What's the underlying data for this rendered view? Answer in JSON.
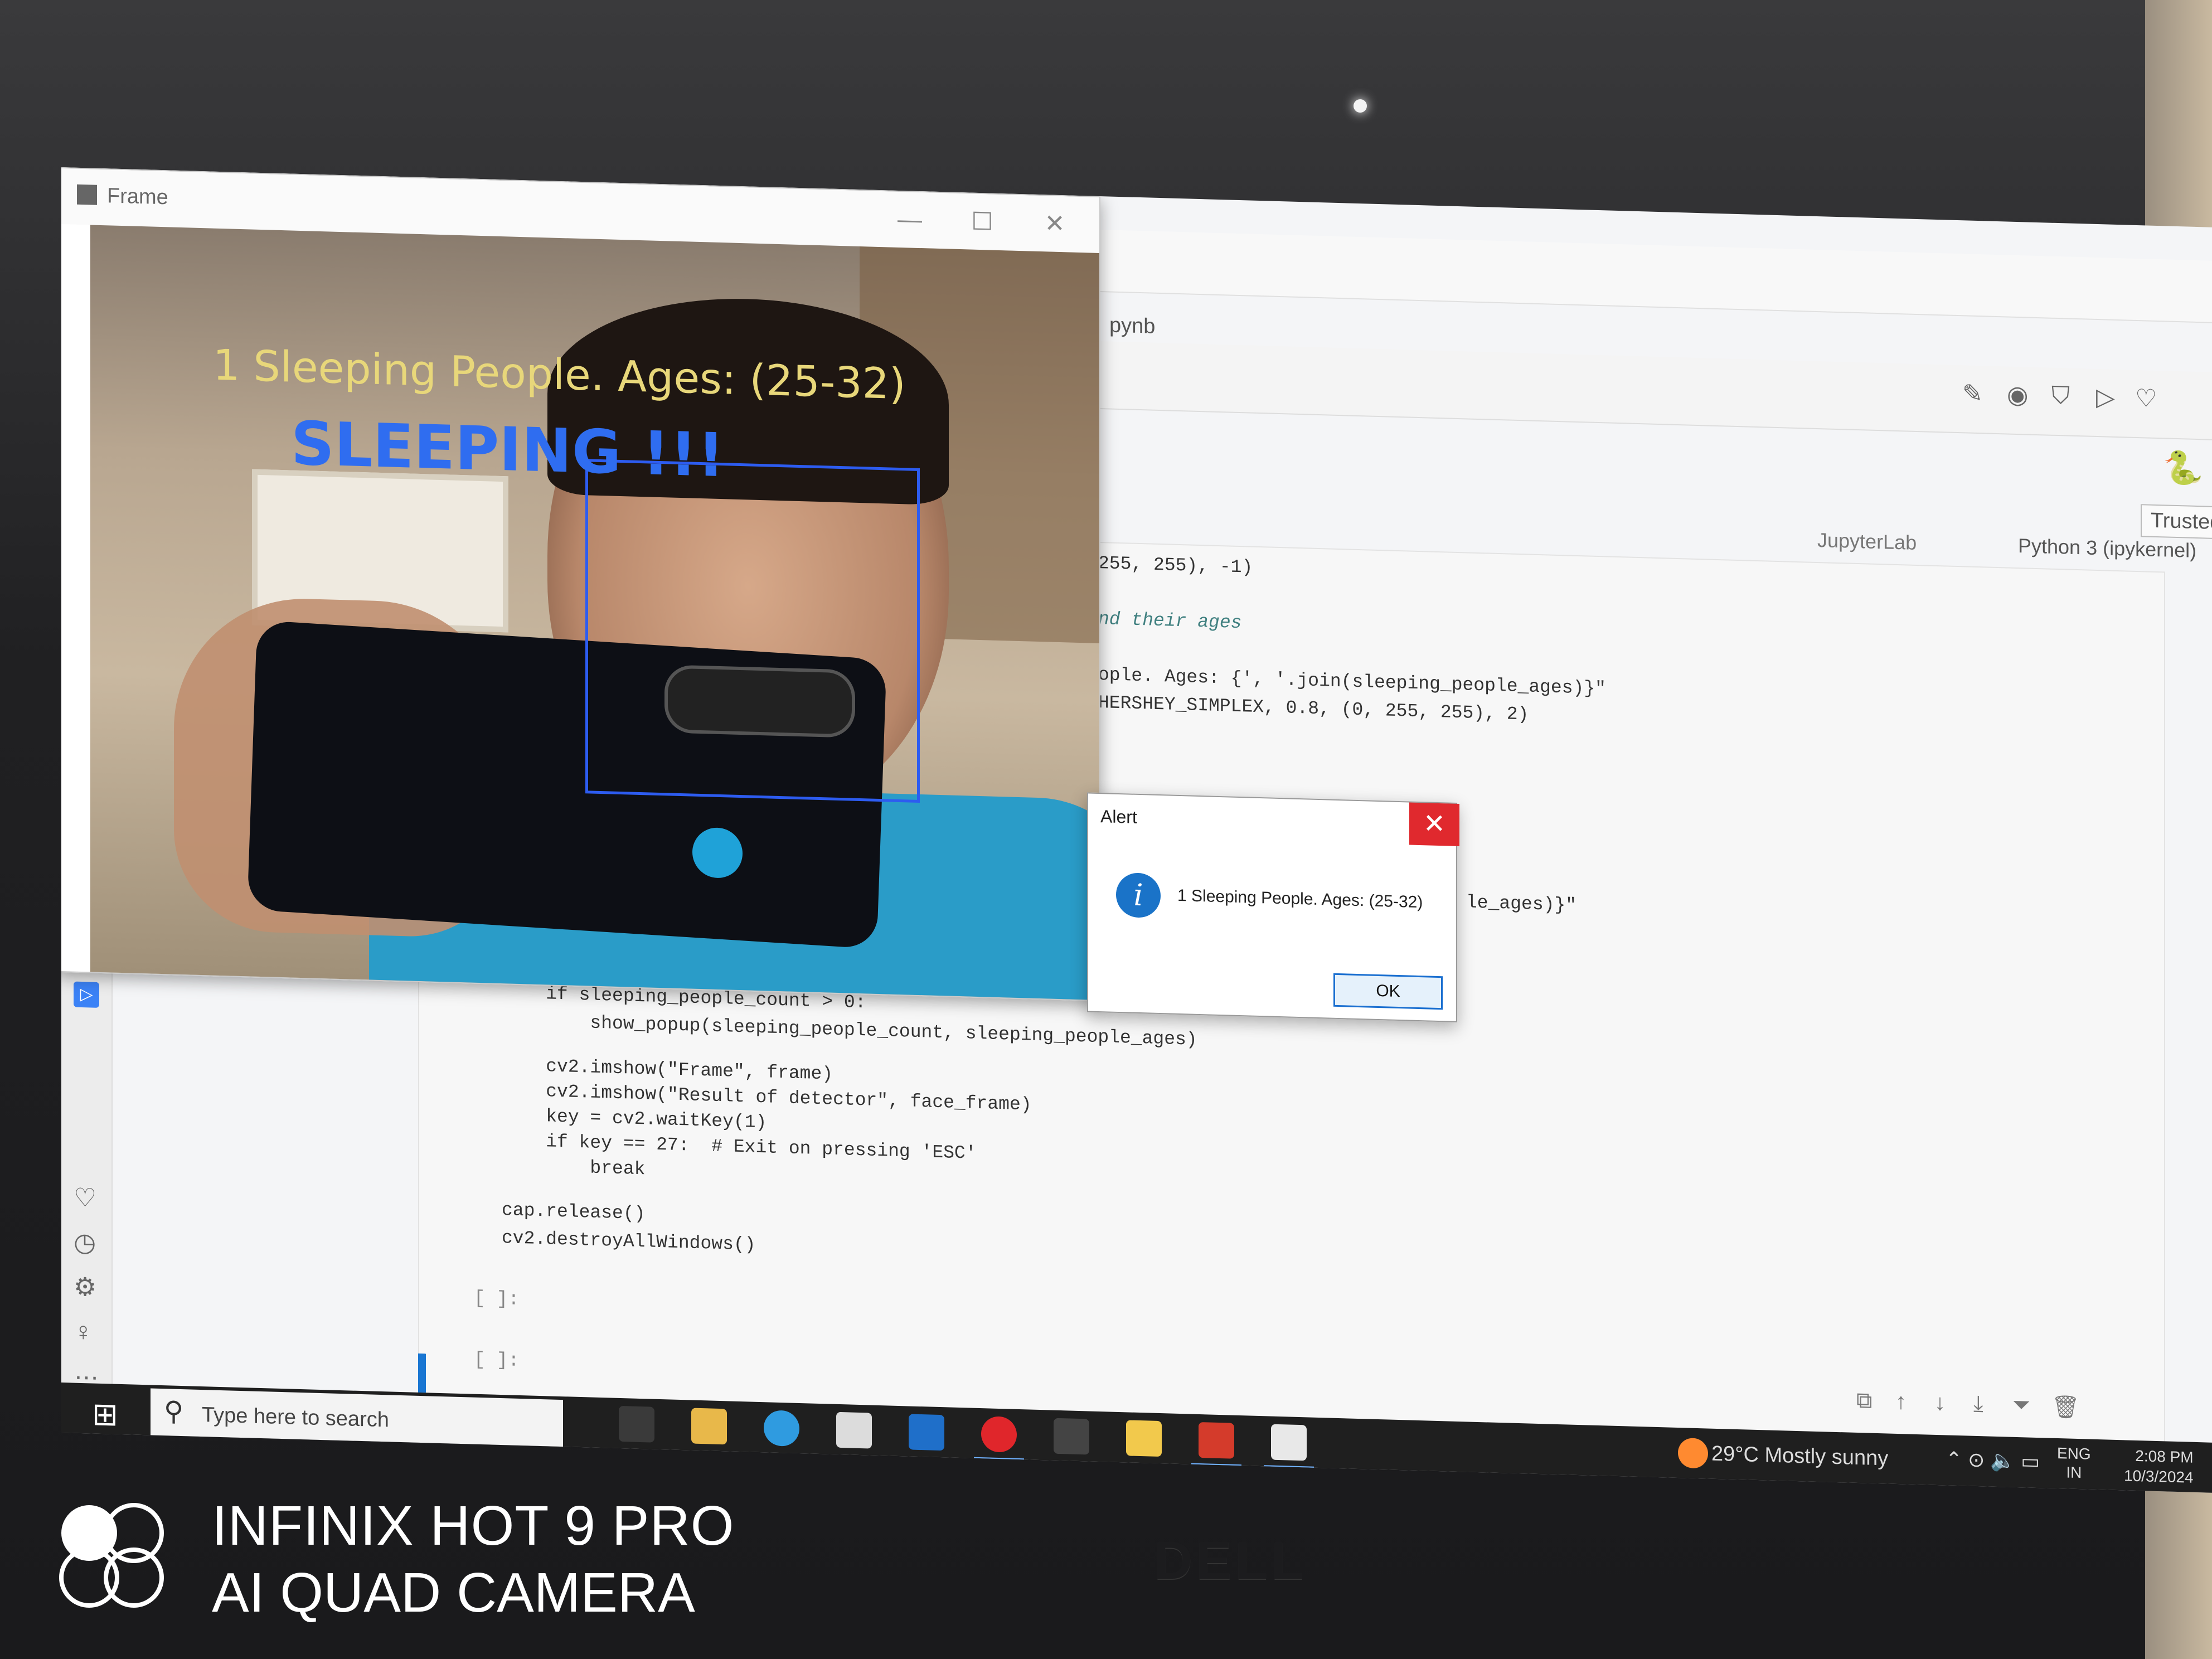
{
  "frame_window": {
    "title": "Frame",
    "overlay_count_text": "1 Sleeping People. Ages: (25-32)",
    "overlay_status_text": "SLEEPING !!!"
  },
  "alert": {
    "title": "Alert",
    "message": "1 Sleeping People. Ages: (25-32)",
    "ok_label": "OK"
  },
  "notebook": {
    "tab_label": "pynb",
    "trusted_label": "Trusted",
    "jupyterlab_label": "JupyterLab",
    "kernel_label": "Python 3 (ipykernel)",
    "code_lines_right": [
      "255, 255), -1)",
      "nd their ages",
      "ople. Ages: {', '.join(sleeping_people_ages)}\"",
      "HERSHEY_SIMPLEX, 0.8, (0, 255, 255), 2)",
      "le_ages)}\""
    ],
    "code_lines_bottom": [
      "    if sleeping_people_count > 0:",
      "        show_popup(sleeping_people_count, sleeping_people_ages)",
      "    cv2.imshow(\"Frame\", frame)",
      "    cv2.imshow(\"Result of detector\", face_frame)",
      "    key = cv2.waitKey(1)",
      "    if key == 27:  # Exit on pressing 'ESC'",
      "        break",
      "cap.release()",
      "cv2.destroyAllWindows()"
    ],
    "empty_prompt": "[ ]:"
  },
  "taskbar": {
    "search_placeholder": "Type here to search",
    "weather": "29°C  Mostly sunny",
    "lang_line1": "ENG",
    "lang_line2": "IN",
    "time": "2:08 PM",
    "date": "10/3/2024"
  },
  "laptop": {
    "brand": "DELL"
  },
  "camera_watermark": {
    "line1": "INFINIX HOT 9 PRO",
    "line2": "AI QUAD CAMERA"
  }
}
